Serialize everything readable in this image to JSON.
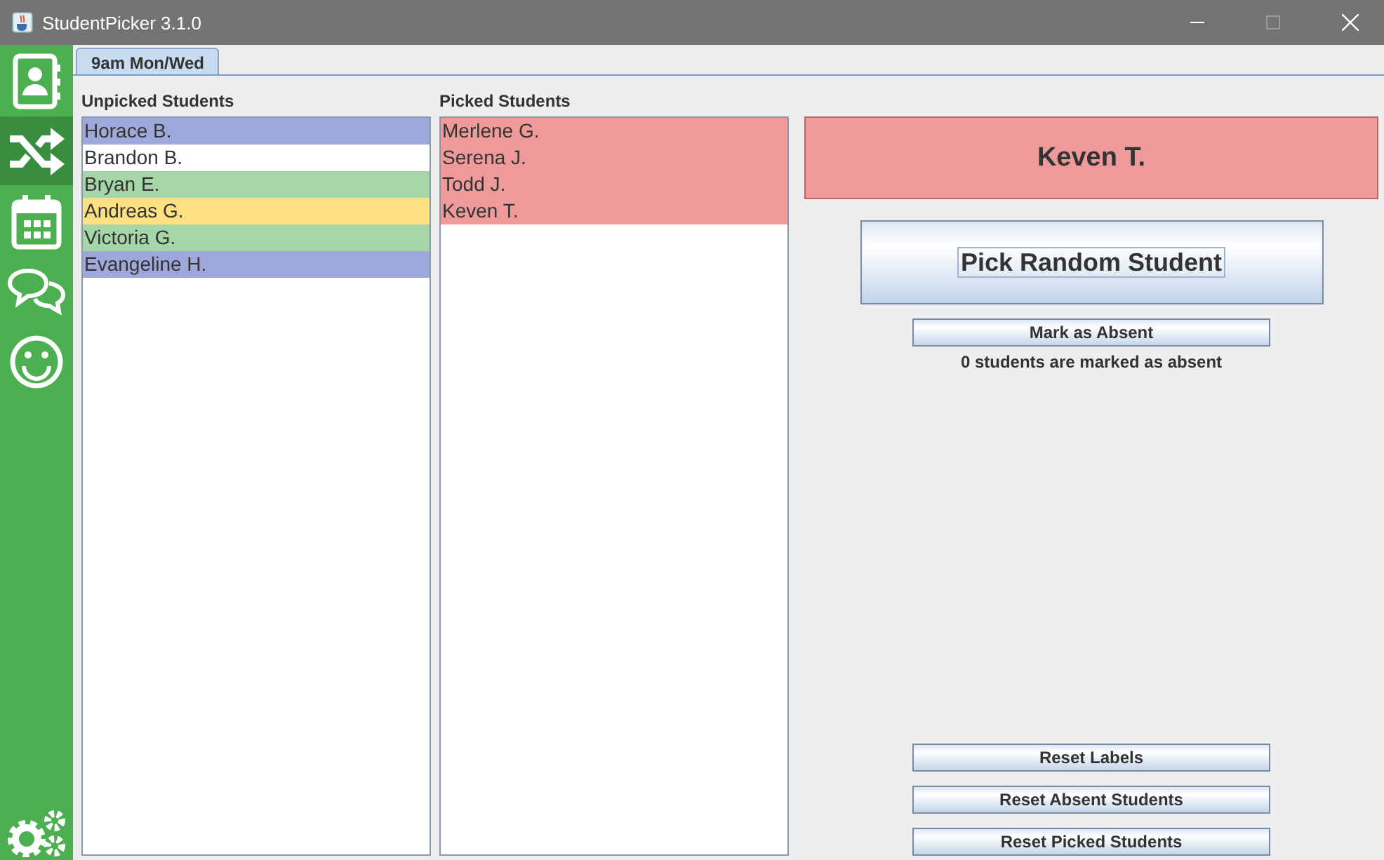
{
  "window": {
    "title": "StudentPicker 3.1.0"
  },
  "sidebar": {
    "items": [
      {
        "selected": false
      },
      {
        "selected": true
      },
      {
        "selected": false
      },
      {
        "selected": false
      },
      {
        "selected": false
      }
    ]
  },
  "tabs": [
    {
      "label": "9am Mon/Wed",
      "selected": true
    }
  ],
  "unpicked": {
    "label": "Unpicked Students",
    "items": [
      {
        "name": "Horace B.",
        "color": "#9fa8da"
      },
      {
        "name": "Brandon B.",
        "color": "#ffffff"
      },
      {
        "name": "Bryan E.",
        "color": "#a5d6a7"
      },
      {
        "name": "Andreas G.",
        "color": "#ffe082"
      },
      {
        "name": "Victoria G.",
        "color": "#a5d6a7"
      },
      {
        "name": "Evangeline H.",
        "color": "#9fa8da"
      }
    ]
  },
  "picked": {
    "label": "Picked Students",
    "items": [
      {
        "name": "Merlene G.",
        "color": "#ef9a9a"
      },
      {
        "name": "Serena J.",
        "color": "#ef9a9a"
      },
      {
        "name": "Todd J.",
        "color": "#ef9a9a"
      },
      {
        "name": "Keven T.",
        "color": "#ef9a9a"
      }
    ]
  },
  "current": {
    "name": "Keven T.",
    "color": "#ef9a9a"
  },
  "pick_button": {
    "label": "Pick Random Student",
    "focused": true
  },
  "absent_button": {
    "label": "Mark as Absent"
  },
  "absent_count": "0 students are marked as absent",
  "reset_buttons": [
    "Reset Labels",
    "Reset Absent Students",
    "Reset Picked Students"
  ]
}
